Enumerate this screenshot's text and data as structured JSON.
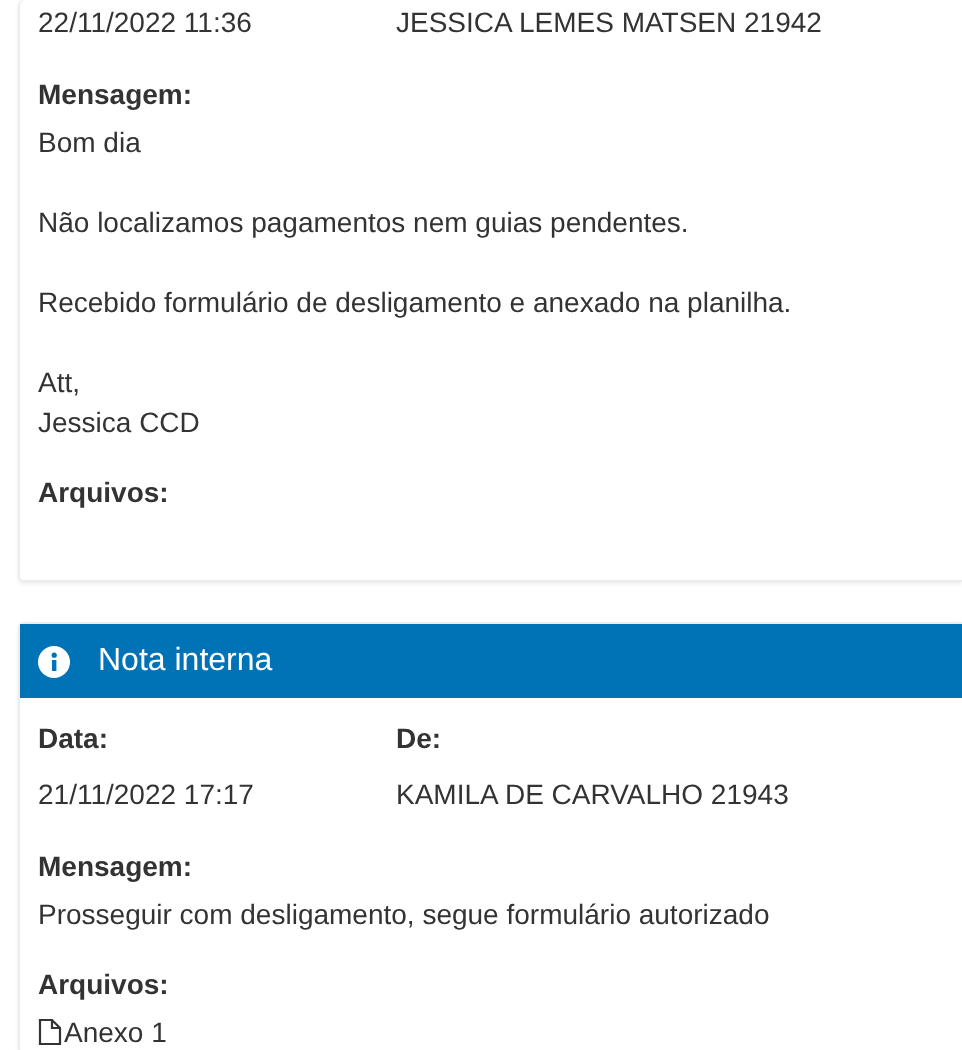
{
  "cards": [
    {
      "fields": [
        {
          "value": "22/11/2022 11:36"
        },
        {
          "value": "JESSICA LEMES MATSEN 21942"
        }
      ],
      "message_label": "Mensagem:",
      "message": [
        [
          "Bom dia"
        ],
        [
          "Não localizamos pagamentos nem guias pendentes."
        ],
        [
          "Recebido formulário de desligamento e anexado na planilha."
        ],
        [
          "Att,",
          "Jessica CCD"
        ]
      ],
      "files_label": "Arquivos:"
    },
    {
      "header": {
        "title": "Nota interna"
      },
      "fields": [
        {
          "label": "Data:",
          "value": "21/11/2022 17:17"
        },
        {
          "label": "De:",
          "value": "KAMILA DE CARVALHO 21943"
        }
      ],
      "message_label": "Mensagem:",
      "message": [
        [
          "Prosseguir com desligamento, segue formulário autorizado"
        ]
      ],
      "files_label": "Arquivos:",
      "files": [
        {
          "name": "Anexo 1"
        }
      ]
    }
  ]
}
